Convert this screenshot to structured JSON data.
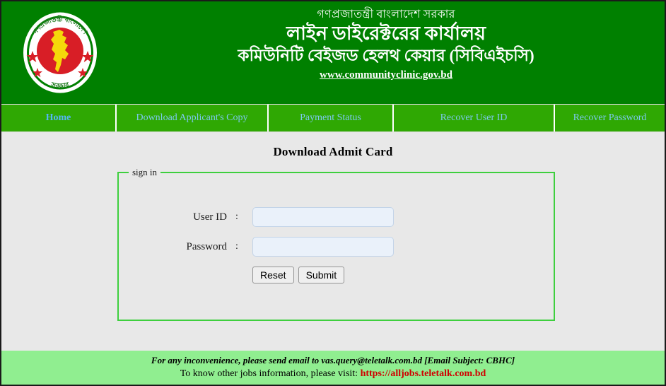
{
  "header": {
    "emblem_name": "bangladesh-government-emblem",
    "gov_line": "গণপ্রজাতন্ত্রী বাংলাদেশ সরকার",
    "office_line": "লাইন ডাইরেক্টরের কার্যালয়",
    "cbhc_line": "কমিউনিটি বেইজড হেলথ কেয়ার (সিবিএইচসি)",
    "site_link": "www.communityclinic.gov.bd",
    "bg_color": "#008000"
  },
  "nav": {
    "bg_color": "#2fa803",
    "link_color": "#7ec8f0",
    "items": [
      {
        "label": "Home",
        "active": true
      },
      {
        "label": "Download Applicant's Copy",
        "active": false
      },
      {
        "label": "Payment Status",
        "active": false
      },
      {
        "label": "Recover User ID",
        "active": false
      },
      {
        "label": "Recover Password",
        "active": false
      }
    ]
  },
  "main": {
    "page_title": "Download Admit Card",
    "fieldset_legend": "sign in",
    "fieldset_border_color": "#3ecf3e",
    "fields": [
      {
        "label": "User ID",
        "colon": ":",
        "value": "",
        "placeholder": ""
      },
      {
        "label": "Password",
        "colon": ":",
        "value": "",
        "placeholder": ""
      }
    ],
    "buttons": [
      {
        "label": "Reset"
      },
      {
        "label": "Submit"
      }
    ]
  },
  "footer": {
    "bg_color": "#90ee90",
    "line1": "For any inconvenience, please send email to vas.query@teletalk.com.bd  [Email Subject: CBHC]",
    "line2_prefix": "To know other jobs information, please visit: ",
    "line2_link": "https://alljobs.teletalk.com.bd",
    "link_color": "#d00000"
  }
}
